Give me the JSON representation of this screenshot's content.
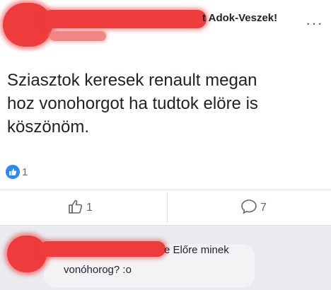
{
  "post": {
    "group_name": "t Adok-Veszek!",
    "text": "Sziasztok keresek renault megan\nhoz vonohorgot ha tudtok elöre is\nköszönöm.",
    "reaction_count": "1"
  },
  "actions": {
    "like_count": "1",
    "comment_count": "7"
  },
  "comment": {
    "line1": "e Előre minek",
    "line2": "vonóhorog? :o"
  },
  "icons": {
    "more": "more-options-icon",
    "reaction": "like-reaction-icon",
    "like": "thumbs-up-icon",
    "comment": "comment-bubble-icon"
  },
  "colors": {
    "redaction": "#ee3b3b",
    "like_blue": "#2d88ff",
    "text": "#1d2129",
    "muted": "#606770"
  }
}
